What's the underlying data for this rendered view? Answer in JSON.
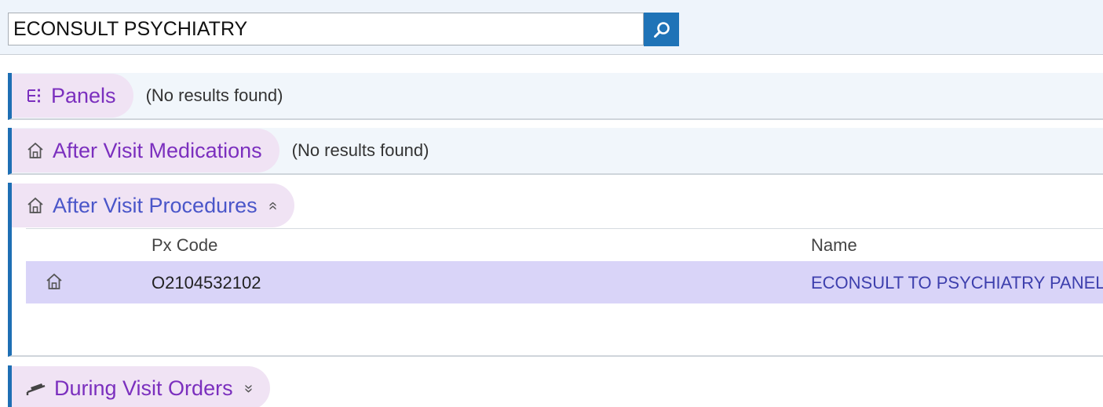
{
  "search": {
    "value": "ECONSULT PSYCHIATRY",
    "button_icon": "search-icon"
  },
  "sections": {
    "panels": {
      "title": "Panels",
      "icon": "panels-list-icon",
      "note": "(No results found)"
    },
    "after_visit_medications": {
      "title": "After Visit Medications",
      "icon": "home-icon",
      "note": "(No results found)"
    },
    "after_visit_procedures": {
      "title": "After Visit Procedures",
      "icon": "home-icon",
      "toggle_icon": "chevron-double-up-icon",
      "toggle_glyph": "»",
      "columns": {
        "px_code": "Px Code",
        "name": "Name"
      },
      "rows": [
        {
          "icon": "home-icon",
          "px_code": "O2104532102",
          "name": "ECONSULT TO PSYCHIATRY PANEL"
        }
      ]
    },
    "during_visit_orders": {
      "title": "During Visit Orders",
      "icon": "bed-icon",
      "toggle_icon": "chevron-double-down-icon",
      "toggle_glyph": "»"
    }
  },
  "colors": {
    "accent_blue": "#1e6fb4",
    "title_purple": "#7b2fbe",
    "pill_bg": "#f0e3f4",
    "row_highlight": "#d9d4f8"
  }
}
